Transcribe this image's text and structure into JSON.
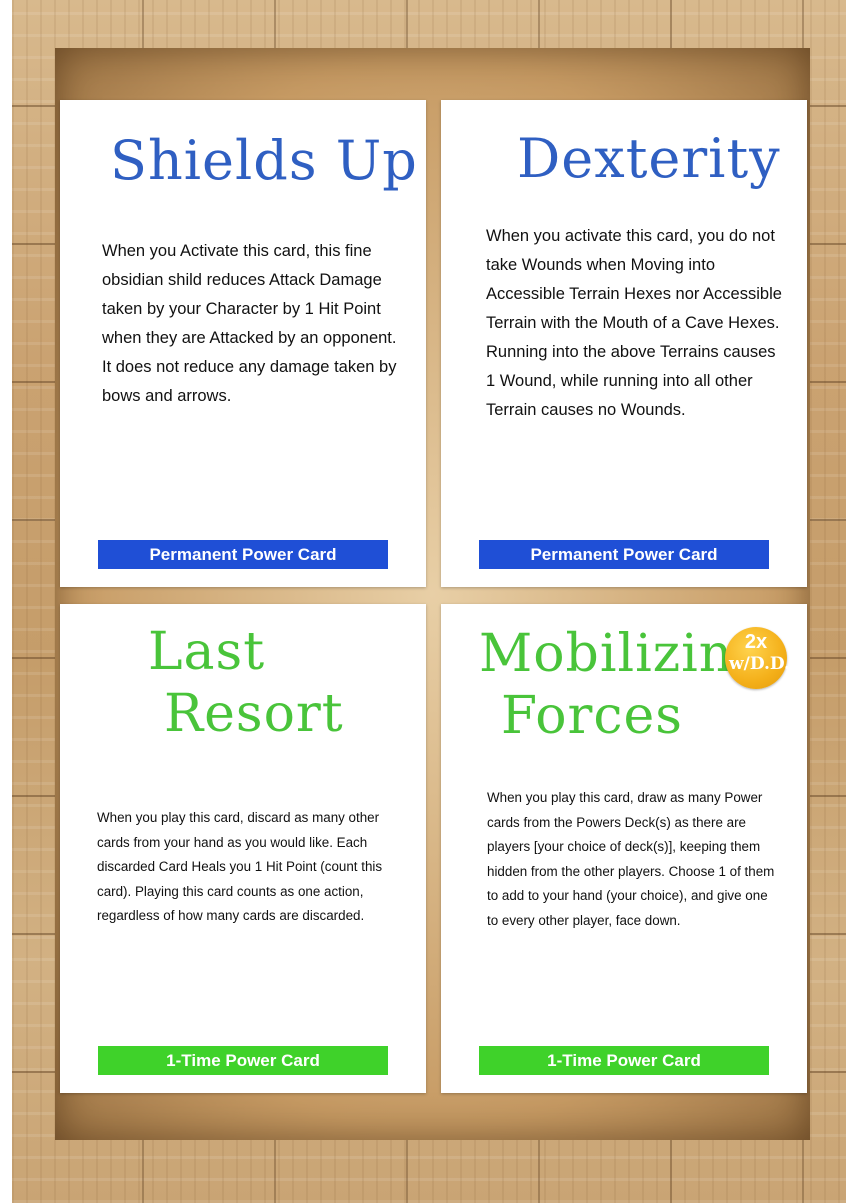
{
  "cards": [
    {
      "title": "Shields Up",
      "body": "When you Activate this card, this fine obsidian shild reduces Attack Damage taken by your Character by 1 Hit Point when they are Attacked by an opponent.  It does not reduce any damage taken by bows and arrows.",
      "banner": "Permanent Power Card"
    },
    {
      "title": "Dexterity",
      "body": "When you activate this card, you do not take Wounds when Moving into Accessible Terrain Hexes nor Accessible Terrain with the Mouth of a Cave Hexes.  Running into the above Terrains causes 1 Wound, while running into all other Terrain causes no Wounds.",
      "banner": "Permanent Power Card"
    },
    {
      "title_line1": "Last",
      "title_line2": "Resort",
      "body": "When you play this card, discard as many other cards from your hand as you would like. Each discarded Card Heals you 1 Hit Point (count this card). Playing this card counts as one action, regardless of how many cards are discarded.",
      "banner": "1-Time Power Card"
    },
    {
      "title_line1": "Mobilizing",
      "title_line2": "Forces",
      "badge_top": "2x",
      "badge_bottom": "w/D.D.",
      "body": "When you play this card, draw as many Power cards from the Powers Deck(s) as there are players [your choice of deck(s)], keeping them hidden from the other players. Choose 1 of them to add to your hand (your choice), and give one to every other player, face down.",
      "banner": "1-Time Power Card"
    }
  ],
  "colors": {
    "permanent": "#1f4fd6",
    "one_time": "#3fd22a",
    "title_blue": "#2f5fc2",
    "title_green": "#49c43a"
  }
}
